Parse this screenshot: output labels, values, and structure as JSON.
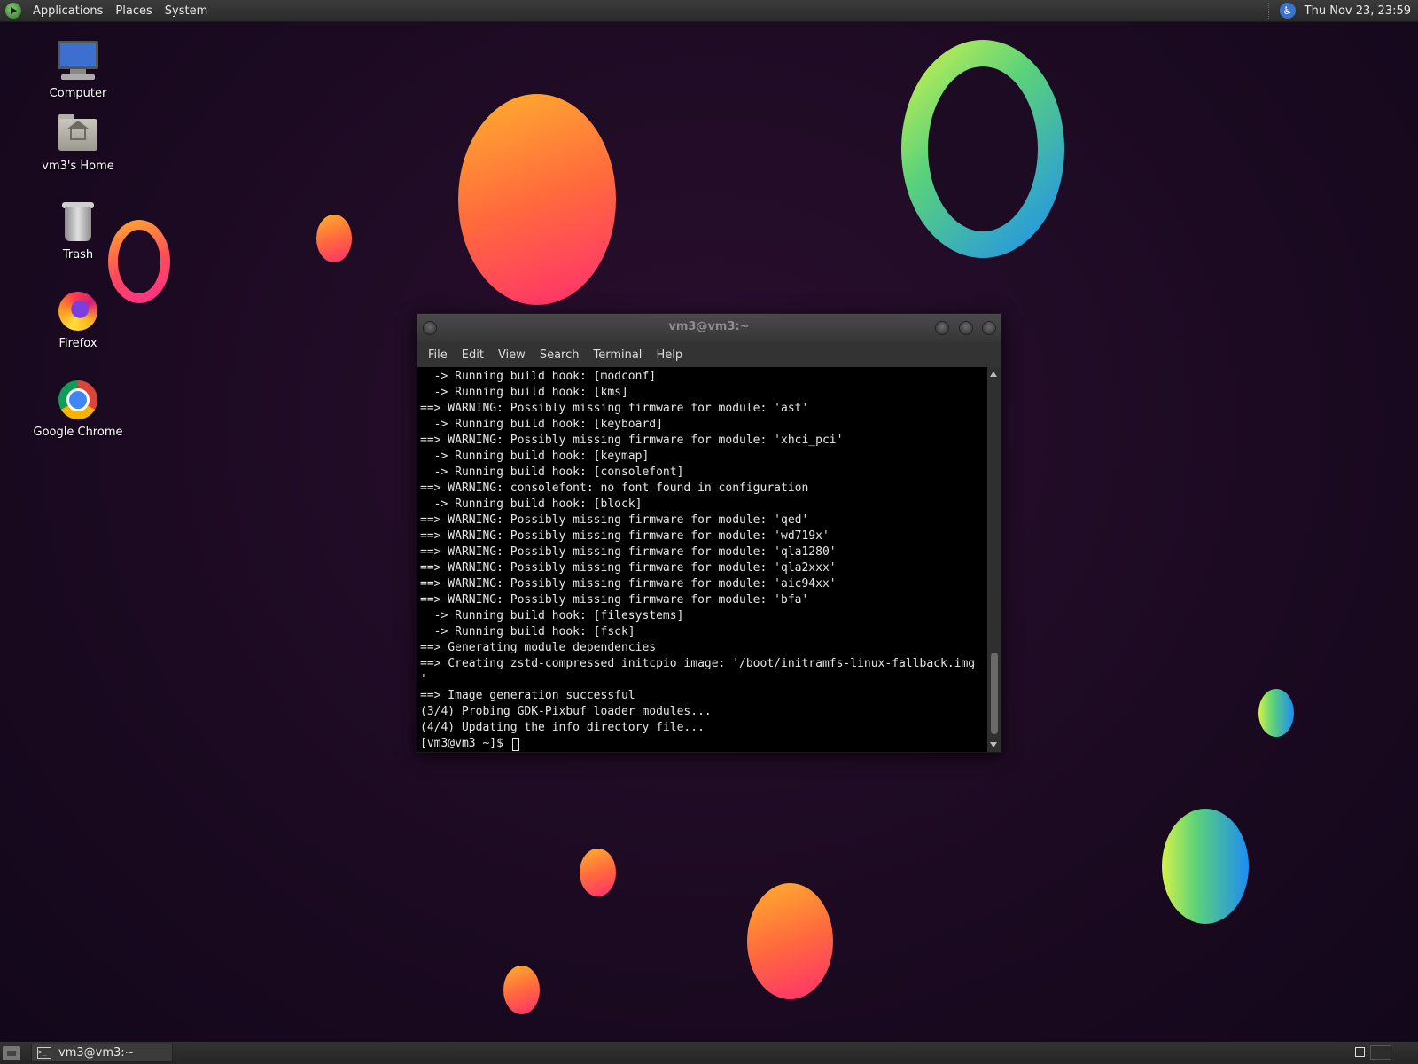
{
  "top_panel": {
    "menus": [
      "Applications",
      "Places",
      "System"
    ],
    "clock": "Thu Nov 23, 23:59"
  },
  "desktop_icons": [
    {
      "label": "Computer",
      "icon": "computer-icon"
    },
    {
      "label": "vm3's Home",
      "icon": "home-folder-icon"
    },
    {
      "label": "Trash",
      "icon": "trash-icon"
    },
    {
      "label": "Firefox",
      "icon": "firefox-icon"
    },
    {
      "label": "Google Chrome",
      "icon": "chrome-icon"
    }
  ],
  "terminal": {
    "title": "vm3@vm3:~",
    "menu": [
      "File",
      "Edit",
      "View",
      "Search",
      "Terminal",
      "Help"
    ],
    "lines": [
      "  -> Running build hook: [modconf]",
      "  -> Running build hook: [kms]",
      "==> WARNING: Possibly missing firmware for module: 'ast'",
      "  -> Running build hook: [keyboard]",
      "==> WARNING: Possibly missing firmware for module: 'xhci_pci'",
      "  -> Running build hook: [keymap]",
      "  -> Running build hook: [consolefont]",
      "==> WARNING: consolefont: no font found in configuration",
      "  -> Running build hook: [block]",
      "==> WARNING: Possibly missing firmware for module: 'qed'",
      "==> WARNING: Possibly missing firmware for module: 'wd719x'",
      "==> WARNING: Possibly missing firmware for module: 'qla1280'",
      "==> WARNING: Possibly missing firmware for module: 'qla2xxx'",
      "==> WARNING: Possibly missing firmware for module: 'aic94xx'",
      "==> WARNING: Possibly missing firmware for module: 'bfa'",
      "  -> Running build hook: [filesystems]",
      "  -> Running build hook: [fsck]",
      "==> Generating module dependencies",
      "==> Creating zstd-compressed initcpio image: '/boot/initramfs-linux-fallback.img",
      "'",
      "==> Image generation successful",
      "(3/4) Probing GDK-Pixbuf loader modules...",
      "(4/4) Updating the info directory file..."
    ],
    "prompt": "[vm3@vm3 ~]$ "
  },
  "taskbar": {
    "window_button": "vm3@vm3:~"
  },
  "colors": {
    "desktop_bg": "#1c0a22",
    "panel": "#2b2b2b",
    "terminal_bg": "#000000",
    "terminal_fg": "#e6e6e6"
  }
}
